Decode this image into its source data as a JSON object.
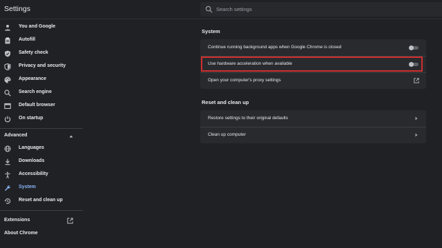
{
  "app": {
    "title": "Settings"
  },
  "search": {
    "placeholder": "Search settings",
    "icon": "search-icon"
  },
  "sidebar": {
    "items": [
      {
        "label": "You and Google",
        "icon": "person-icon"
      },
      {
        "label": "Autofill",
        "icon": "clipboard-icon"
      },
      {
        "label": "Safety check",
        "icon": "shield-check-icon"
      },
      {
        "label": "Privacy and security",
        "icon": "shield-icon"
      },
      {
        "label": "Appearance",
        "icon": "palette-icon"
      },
      {
        "label": "Search engine",
        "icon": "search-icon"
      },
      {
        "label": "Default browser",
        "icon": "browser-icon"
      },
      {
        "label": "On startup",
        "icon": "power-icon"
      }
    ],
    "advanced_label": "Advanced",
    "advanced_items": [
      {
        "label": "Languages",
        "icon": "globe-icon"
      },
      {
        "label": "Downloads",
        "icon": "download-icon"
      },
      {
        "label": "Accessibility",
        "icon": "accessibility-icon"
      },
      {
        "label": "System",
        "icon": "wrench-icon",
        "active": true
      },
      {
        "label": "Reset and clean up",
        "icon": "history-icon"
      }
    ],
    "extensions_label": "Extensions",
    "about_label": "About Chrome"
  },
  "system": {
    "title": "System",
    "rows": [
      {
        "label": "Continue running background apps when Google Chrome is closed",
        "control": "toggle",
        "enabled": false
      },
      {
        "label": "Use hardware acceleration when available",
        "control": "toggle",
        "enabled": false,
        "highlighted": true
      },
      {
        "label": "Open your computer's proxy settings",
        "control": "external-link-icon"
      }
    ]
  },
  "reset": {
    "title": "Reset and clean up",
    "rows": [
      {
        "label": "Restore settings to their original defaults",
        "control": "chevron-right-icon"
      },
      {
        "label": "Clean up computer",
        "control": "chevron-right-icon"
      }
    ]
  },
  "colors": {
    "background": "#202124",
    "card": "#292a2d",
    "text": "#e8eaed",
    "accent": "#8ab4f8",
    "highlight_box": "#d32f2f"
  }
}
